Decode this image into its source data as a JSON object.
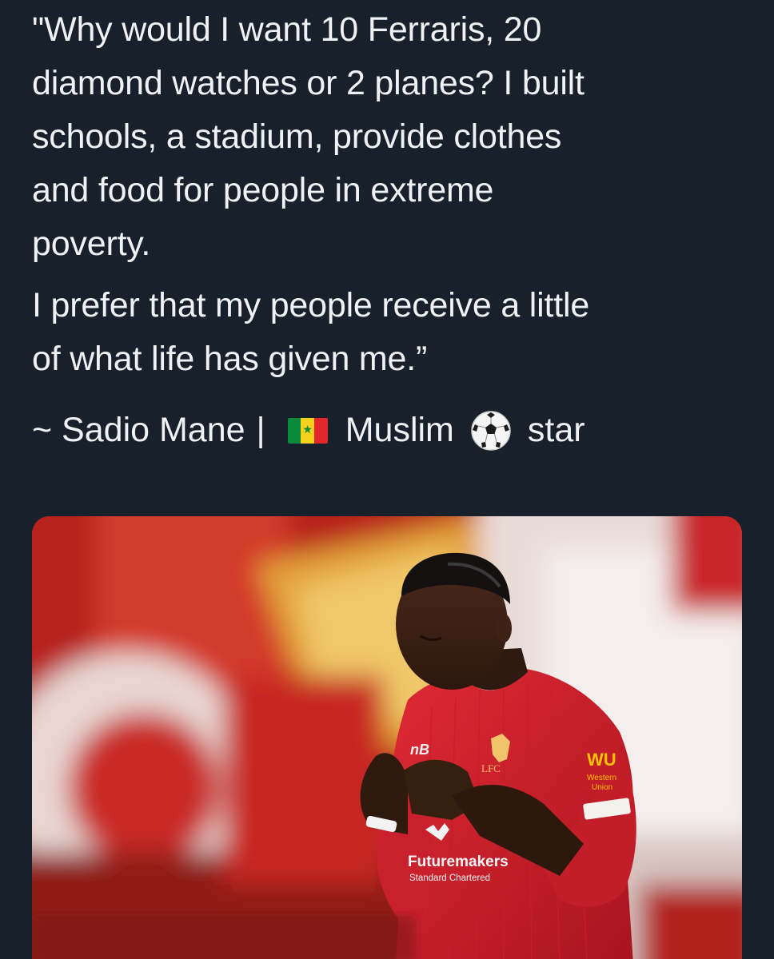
{
  "tweet": {
    "paragraph_1": "\"Why would I want 10 Ferraris, 20\ndiamond watches or 2 planes? I built\nschools, a stadium, provide clothes\nand food for people in extreme\npoverty.",
    "paragraph_2": "I prefer that my people receive a little\nof what life has given me.”",
    "attribution": {
      "name": "~ Sadio Mane",
      "separator": "|",
      "flag_icon": "senegal-flag-icon",
      "word_1": "Muslim",
      "ball_icon": "soccer-ball-icon",
      "word_2": "star"
    }
  },
  "media": {
    "jersey_sponsor": "Futuremakers",
    "jersey_sponsor_sub": "Standard Chartered",
    "club_crest": "LFC",
    "sleeve_sponsor": "Western Union",
    "sleeve_sponsor_mark": "WU"
  },
  "colors": {
    "background": "#17202b",
    "text": "#eef2f5",
    "jersey_red": "#d4202c"
  }
}
